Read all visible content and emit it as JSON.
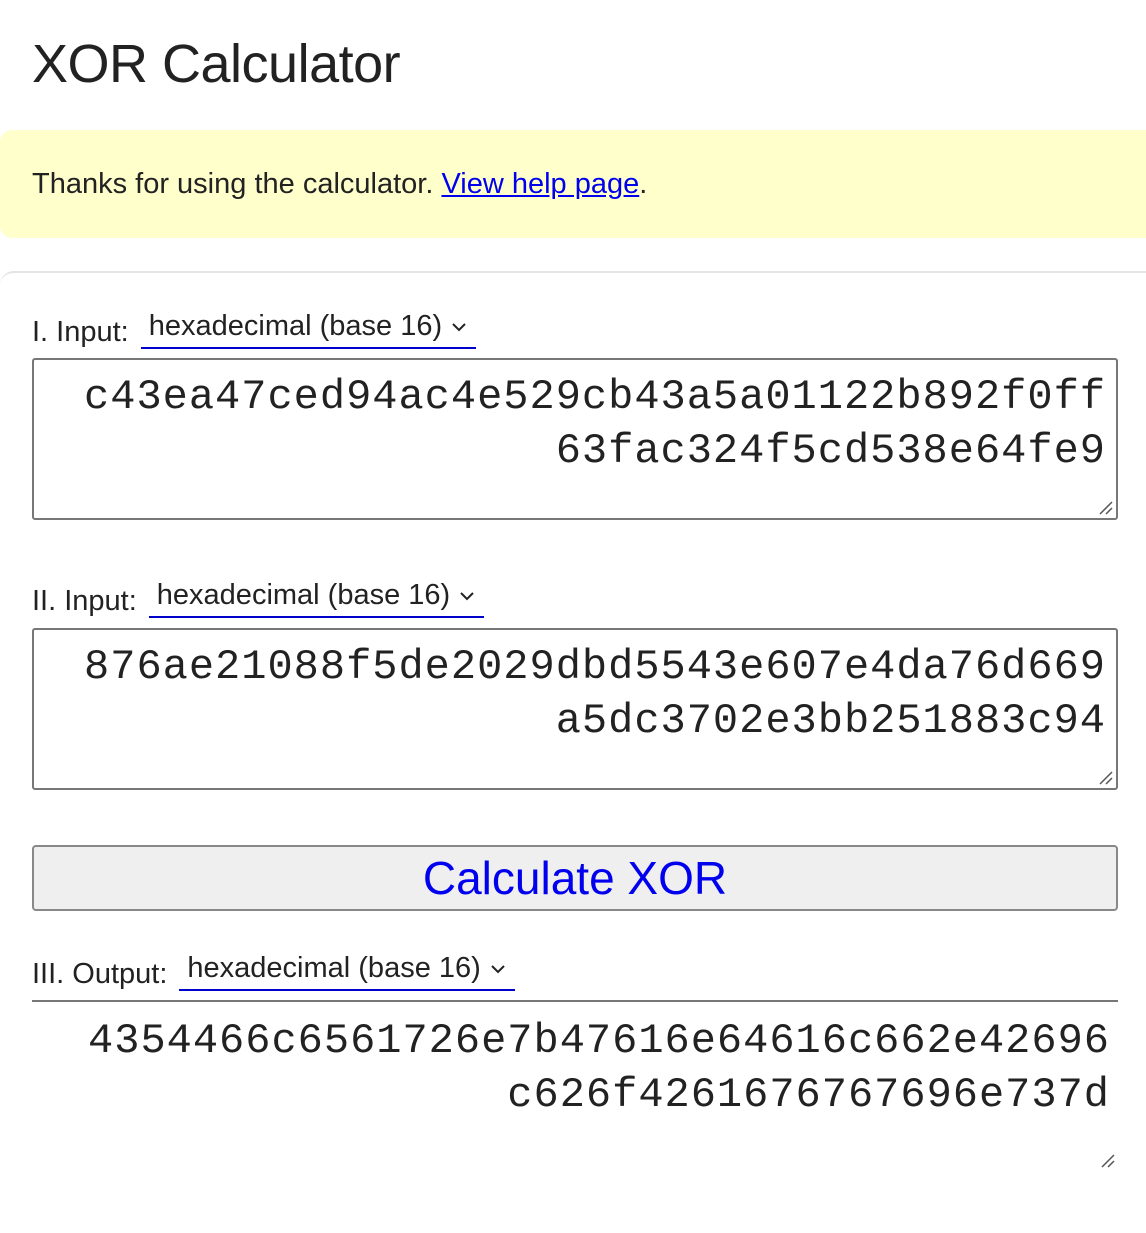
{
  "page": {
    "title": "XOR Calculator"
  },
  "notice": {
    "text": "Thanks for using the calculator. ",
    "link": "View help page",
    "after": "."
  },
  "input1": {
    "label": "I. Input:",
    "base": "hexadecimal (base 16)",
    "value": "c43ea47ced94ac4e529cb43a5a01122b892f0ff63fac324f5cd538e64fe9"
  },
  "input2": {
    "label": "II. Input:",
    "base": "hexadecimal (base 16)",
    "value": "876ae21088f5de2029dbd5543e607e4da76d669a5dc3702e3bb251883c94"
  },
  "button": {
    "label": "Calculate XOR"
  },
  "output": {
    "label": "III. Output:",
    "base": "hexadecimal (base 16)",
    "value": "4354466c6561726e7b47616e64616c662e42696c626f4261676767696e737d"
  },
  "icons": {
    "select": "chevron-down-icon",
    "resize": "resize-grip-icon"
  },
  "colors": {
    "notice_bg": "#ffffcc",
    "link": "#0000ee",
    "select_underline": "#0000cc",
    "button_bg": "#efefef"
  }
}
